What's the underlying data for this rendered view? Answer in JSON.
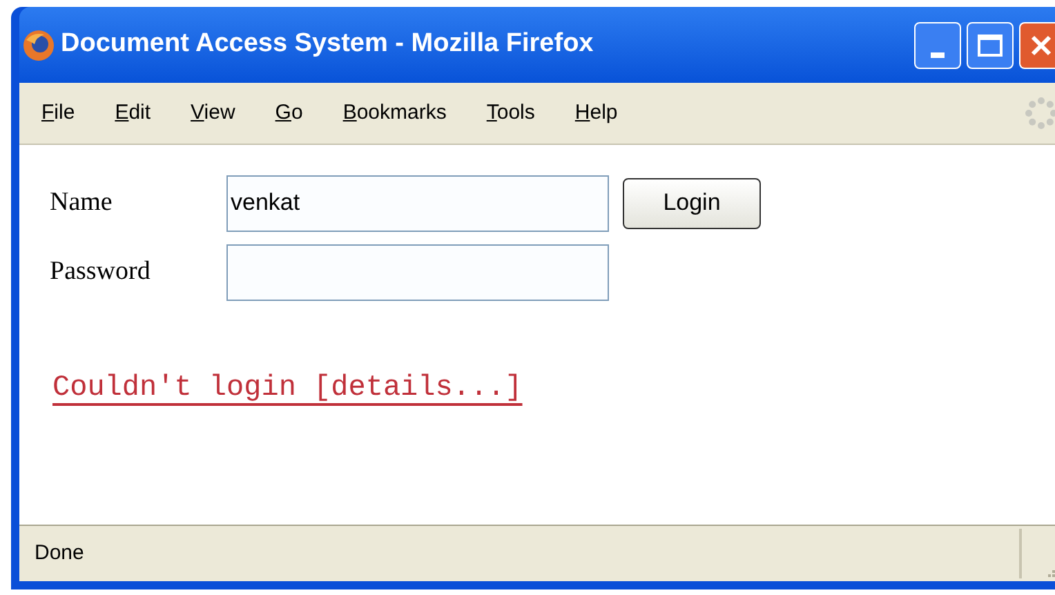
{
  "window": {
    "title": "Document Access System - Mozilla Firefox"
  },
  "menu": [
    "File",
    "Edit",
    "View",
    "Go",
    "Bookmarks",
    "Tools",
    "Help"
  ],
  "form": {
    "name_label": "Name",
    "name_value": "venkat",
    "password_label": "Password",
    "login_button": "Login"
  },
  "error_link": "Couldn't login [details...]",
  "status_bar": "Done"
}
